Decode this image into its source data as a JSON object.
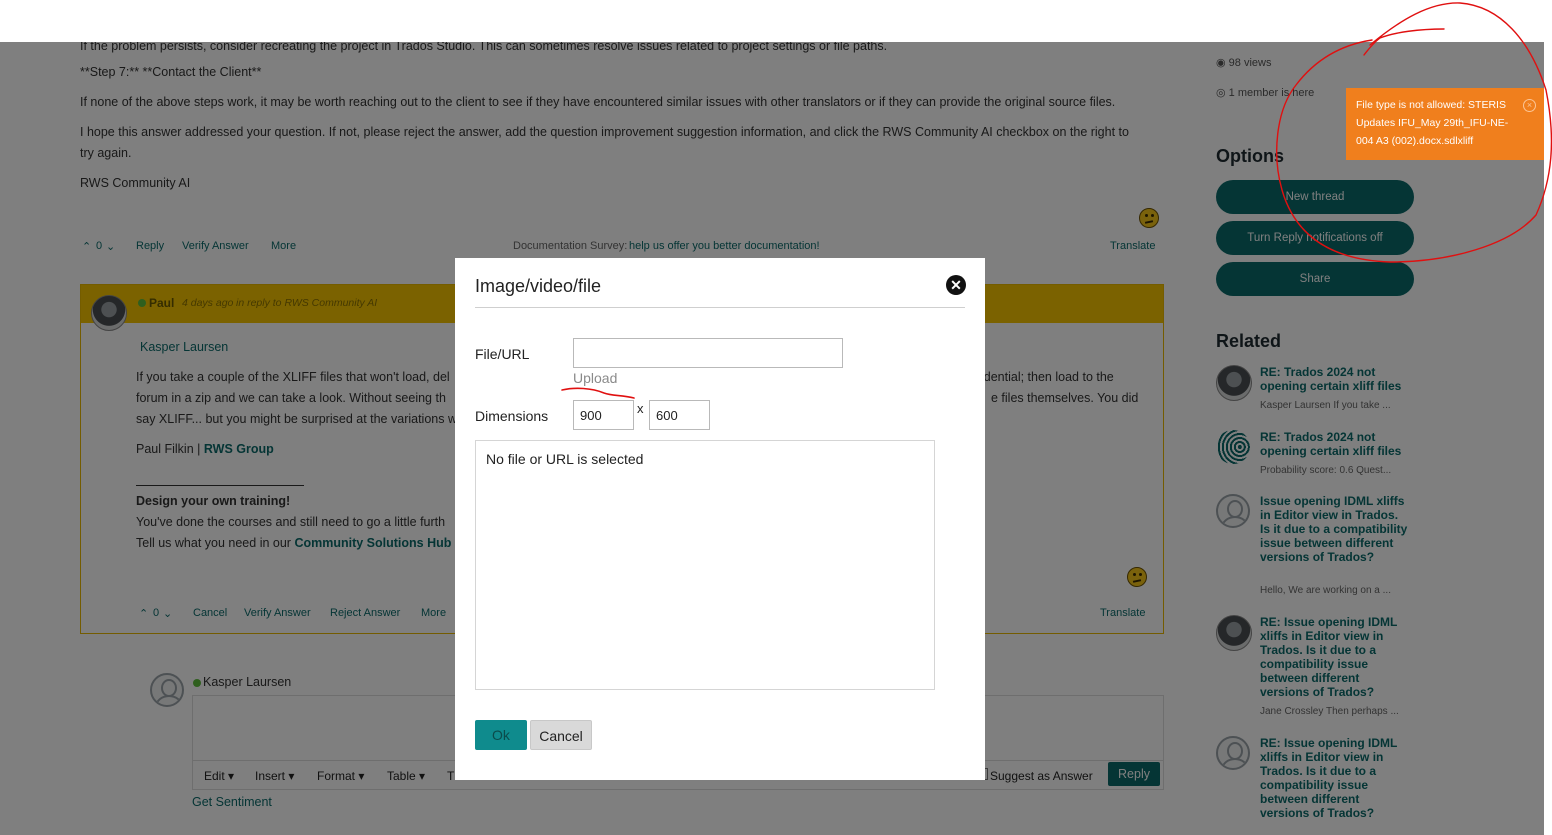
{
  "answer": {
    "p1": "If the problem persists, consider recreating the project in Trados Studio. This can sometimes resolve issues related to project settings or file paths.",
    "p2": "**Step 7:** **Contact the Client**",
    "p3": "If none of the above steps work, it may be worth reaching out to the client to see if they have encountered similar issues with other translators or if they can provide the original source files.",
    "p4a": "I hope this answer addressed your question. If not, please reject the answer, add the question improvement suggestion information, and click the RWS Community AI checkbox on the right to",
    "p4b": "try again.",
    "signature": "RWS Community AI",
    "actions": {
      "votes": "0",
      "reply": "Reply",
      "verify": "Verify Answer",
      "more": "More",
      "translate": "Translate"
    },
    "survey_label": "Documentation Survey:",
    "survey_link": "help us offer you better documentation!"
  },
  "reply": {
    "author": "Paul",
    "time": "4 days ago",
    "in_reply": "in reply to RWS Community AI",
    "mention": "Kasper Laursen",
    "l1a": "If you take a couple of the XLIFF files that won't load, del",
    "l1b": "idential; then load to the",
    "l2a": "forum in a zip and we can take a look.  Without seeing th",
    "l2b": "e files themselves.  You did",
    "l3a": "say XLIFF... but you might be surprised at the variations w",
    "sig_name": "Paul Filkin | ",
    "sig_company": "RWS Group",
    "training_title": "Design your own training!",
    "training_l1": "You've done the courses and still need to go a little furth",
    "training_l2": "Tell us what you need in our ",
    "training_link": "Community Solutions Hub",
    "actions": {
      "votes": "0",
      "cancel": "Cancel",
      "verify": "Verify Answer",
      "reject": "Reject Answer",
      "more": "More",
      "translate": "Translate"
    }
  },
  "composer": {
    "user": "Kasper Laursen",
    "toolbar": {
      "edit": "Edit ▾",
      "insert": "Insert ▾",
      "format": "Format ▾",
      "table": "Table ▾",
      "cut": "T"
    },
    "suggest": "Suggest as Answer",
    "reply": "Reply",
    "sentiment": "Get Sentiment"
  },
  "sidebar": {
    "views": "98 views",
    "members": "1 member is here",
    "options_title": "Options",
    "options": [
      "New thread",
      "Turn Reply notifications off",
      "Share"
    ],
    "related_title": "Related",
    "related": [
      {
        "title": "RE: Trados 2024 not opening certain xliff files",
        "snippet": "Kasper Laursen If you take ..."
      },
      {
        "title": "RE: Trados 2024 not opening certain xliff files",
        "snippet": "Probability score: 0.6 Quest..."
      },
      {
        "title": "Issue opening IDML xliffs in Editor view in Trados. Is it due to a compatibility issue between different versions of Trados?",
        "snippet": "Hello, We are working on a ..."
      },
      {
        "title": "RE: Issue opening IDML xliffs in Editor view in Trados. Is it due to a compatibility issue between different versions of Trados?",
        "snippet": "Jane Crossley Then perhaps ..."
      },
      {
        "title": "RE: Issue opening IDML xliffs in Editor view in Trados. Is it due to a compatibility issue between different versions of Trados?",
        "snippet": ""
      }
    ]
  },
  "toast": {
    "message": "File type is not allowed: STERIS Updates IFU_May 29th_IFU-NE-004 A3 (002).docx.sdlxliff",
    "close": "×"
  },
  "dialog": {
    "title": "Image/video/file",
    "close": "✕",
    "file_label": "File/URL",
    "file_value": "",
    "upload": "Upload",
    "dimensions_label": "Dimensions",
    "width": "900",
    "separator": "x",
    "height": "600",
    "preview_text": "No file or URL is selected",
    "ok": "Ok",
    "cancel": "Cancel"
  },
  "colors": {
    "teal": "#0b6b6b",
    "highlight": "#f7c400",
    "toast": "#f07f1d",
    "annotation": "#e01010"
  }
}
